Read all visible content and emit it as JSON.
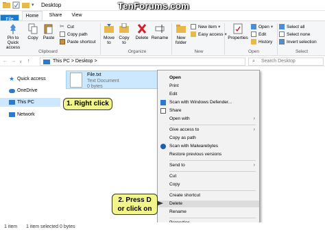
{
  "window": {
    "title": "Desktop",
    "watermark": "TenForums.com"
  },
  "tabs": {
    "file": "File",
    "home": "Home",
    "share": "Share",
    "view": "View"
  },
  "ribbon": {
    "pin_label": "Pin to Quick access",
    "copy_label": "Copy",
    "paste_label": "Paste",
    "cut_label": "Cut",
    "copy_path_label": "Copy path",
    "paste_shortcut_label": "Paste shortcut",
    "clipboard_group": "Clipboard",
    "move_to_label": "Move to",
    "copy_to_label": "Copy to",
    "delete_label": "Delete",
    "rename_label": "Rename",
    "organize_group": "Organize",
    "new_folder_label": "New folder",
    "new_item_label": "New item",
    "easy_access_label": "Easy access",
    "new_group": "New",
    "properties_label": "Properties",
    "open_label": "Open",
    "edit_label": "Edit",
    "history_label": "History",
    "open_group": "Open",
    "select_all_label": "Select all",
    "select_none_label": "Select none",
    "invert_selection_label": "Invert selection",
    "select_group": "Select"
  },
  "address": {
    "breadcrumb": "This PC  >  Desktop  >",
    "search_placeholder": "Search Desktop"
  },
  "nav_pane": {
    "items": [
      "Quick access",
      "OneDrive",
      "This PC",
      "Network"
    ]
  },
  "file_item": {
    "name": "File.txt",
    "type": "Text Document",
    "size": "0 bytes"
  },
  "context_menu": {
    "items": [
      "Open",
      "Print",
      "Edit",
      "Scan with Windows Defender...",
      "Share",
      "Open with",
      "Give access to",
      "Copy as path",
      "Scan with Malwarebytes",
      "Restore previous versions",
      "Send to",
      "Cut",
      "Copy",
      "Create shortcut",
      "Delete",
      "Rename",
      "Properties"
    ]
  },
  "callouts": {
    "step1": "1. Right click",
    "step2_line1": "2. Press D",
    "step2_line2": "or click on"
  },
  "status": {
    "count": "1 item",
    "selected": "1 item selected  0 bytes"
  },
  "colors": {
    "accent": "#1979ca",
    "selection": "#cce8ff",
    "callout": "#f2f58a"
  }
}
